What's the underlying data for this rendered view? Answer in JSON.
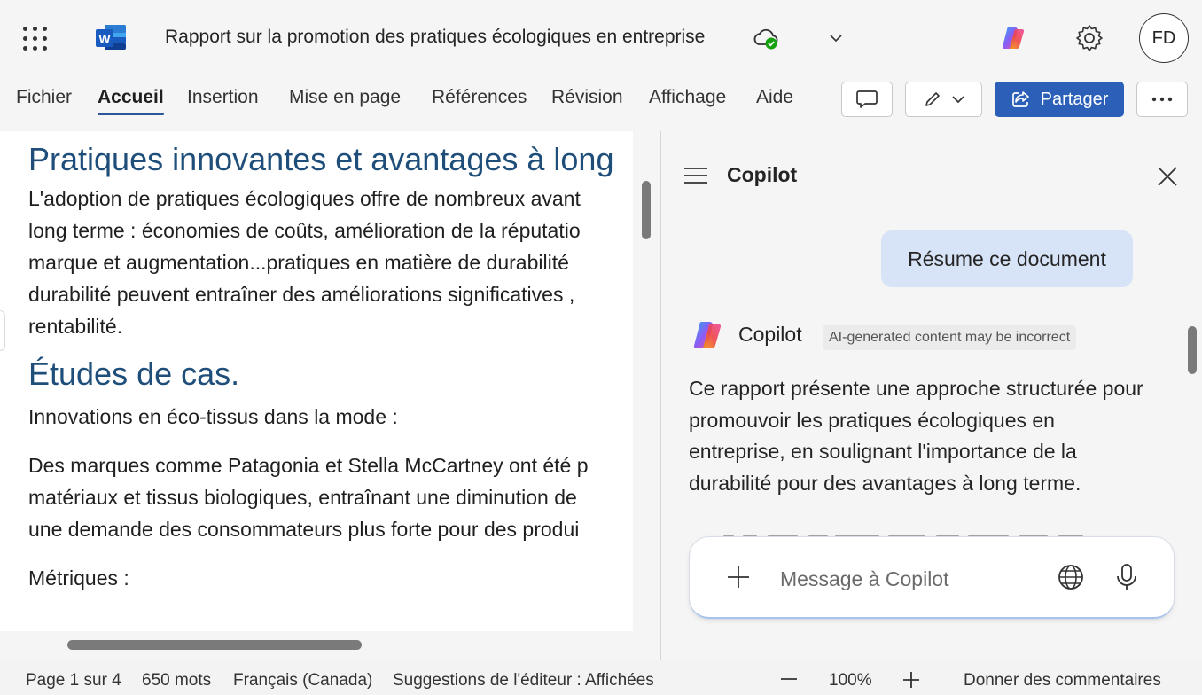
{
  "header": {
    "doc_title": "Rapport sur la promotion des pratiques écologiques en entreprise",
    "avatar_initials": "FD",
    "word_logo_letter": "W"
  },
  "ribbon": {
    "tabs": [
      {
        "label": "Fichier"
      },
      {
        "label": "Accueil",
        "active": true
      },
      {
        "label": "Insertion"
      },
      {
        "label": "Mise en page"
      },
      {
        "label": "Références"
      },
      {
        "label": "Révision"
      },
      {
        "label": "Affichage"
      },
      {
        "label": "Aide"
      }
    ],
    "share_label": "Partager"
  },
  "document": {
    "heading1": "Pratiques innovantes et avantages à long",
    "para1": [
      "L'adoption de pratiques écologiques offre de nombreux avant",
      "long terme : économies de coûts, amélioration de la réputatio",
      "marque et augmentation...pratiques en matière de durabilité",
      "durabilité peuvent entraîner des améliorations significatives ,",
      "rentabilité."
    ],
    "heading2": "Études de cas.",
    "para2": "Innovations en éco-tissus dans la mode :",
    "para3": [
      "Des marques comme Patagonia et Stella McCartney ont été p",
      "matériaux et tissus biologiques, entraînant une diminution de",
      "une demande des consommateurs plus forte pour des produi"
    ],
    "para4": "Métriques :"
  },
  "copilot": {
    "title": "Copilot",
    "user_message": "Résume ce document",
    "bot_name": "Copilot",
    "ai_badge": "AI-generated content may be incorrect",
    "bot_response": "Ce rapport présente une approche structurée pour promouvoir les pratiques écologiques en entreprise, en soulignant l'importance de la durabilité pour des avantages à long terme.",
    "composer_placeholder": "Message à Copilot"
  },
  "status": {
    "page": "Page 1 sur 4",
    "words": "650 mots",
    "language": "Français (Canada)",
    "editor": "Suggestions de l'éditeur : Affichées",
    "zoom": "100%",
    "feedback": "Donner des commentaires"
  },
  "colors": {
    "accent": "#2b5fb8",
    "heading": "#1e4e79",
    "word_blue": "#185abd"
  }
}
